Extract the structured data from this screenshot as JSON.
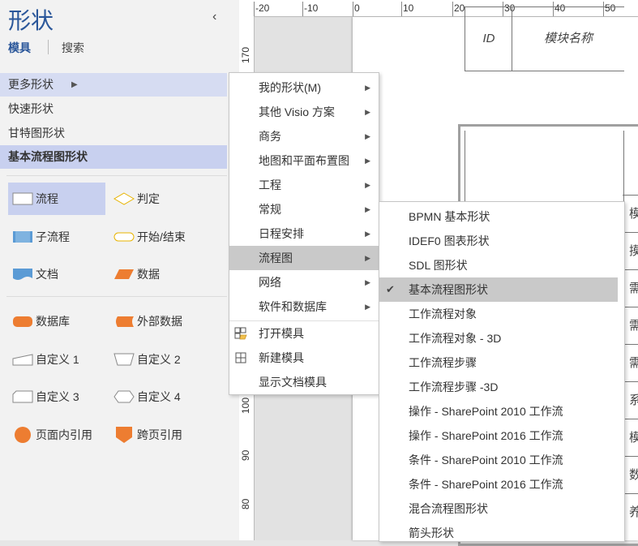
{
  "panel": {
    "title": "形状",
    "tabs": {
      "stencils": "模具",
      "search": "搜索"
    },
    "categories": [
      {
        "label": "更多形状"
      },
      {
        "label": "快速形状"
      },
      {
        "label": "甘特图形状"
      },
      {
        "label": "基本流程图形状"
      }
    ],
    "shapes": [
      {
        "label": "流程",
        "icon": "process-shape-icon"
      },
      {
        "label": "判定",
        "icon": "decision-shape-icon"
      },
      {
        "label": "子流程",
        "icon": "subprocess-shape-icon"
      },
      {
        "label": "开始/结束",
        "icon": "start-end-shape-icon"
      },
      {
        "label": "文档",
        "icon": "document-shape-icon"
      },
      {
        "label": "数据",
        "icon": "data-shape-icon"
      },
      {
        "label": "数据库",
        "icon": "database-shape-icon"
      },
      {
        "label": "外部数据",
        "icon": "external-data-shape-icon"
      },
      {
        "label": "自定义 1",
        "icon": "custom1-shape-icon"
      },
      {
        "label": "自定义 2",
        "icon": "custom2-shape-icon"
      },
      {
        "label": "自定义 3",
        "icon": "custom3-shape-icon"
      },
      {
        "label": "自定义 4",
        "icon": "custom4-shape-icon"
      },
      {
        "label": "页面内引用",
        "icon": "on-page-reference-icon"
      },
      {
        "label": "跨页引用",
        "icon": "off-page-reference-icon"
      }
    ]
  },
  "ruler": {
    "top_labels": [
      "-20",
      "-10",
      "0",
      "10",
      "20",
      "30",
      "40",
      "50"
    ],
    "left_labels": [
      "170",
      "100",
      "90",
      "80"
    ]
  },
  "canvas": {
    "table_headers": [
      "ID",
      "模块名称"
    ],
    "right_cells": [
      "模",
      "摸",
      "需",
      "需",
      "需",
      "系",
      "模",
      "数",
      "养"
    ]
  },
  "menu": {
    "items": [
      {
        "label": "我的形状(M)",
        "has_sub": true
      },
      {
        "label": "其他 Visio 方案",
        "has_sub": true
      },
      {
        "label": "商务",
        "has_sub": true
      },
      {
        "label": "地图和平面布置图",
        "has_sub": true
      },
      {
        "label": "工程",
        "has_sub": true
      },
      {
        "label": "常规",
        "has_sub": true
      },
      {
        "label": "日程安排",
        "has_sub": true
      },
      {
        "label": "流程图",
        "has_sub": true
      },
      {
        "label": "网络",
        "has_sub": true
      },
      {
        "label": "软件和数据库",
        "has_sub": true
      }
    ],
    "actions": [
      {
        "label": "打开模具",
        "icon": "open-stencil-icon"
      },
      {
        "label": "新建模具",
        "icon": "new-stencil-icon"
      },
      {
        "label": "显示文档模具",
        "icon": ""
      }
    ]
  },
  "submenu": {
    "items": [
      "BPMN 基本形状",
      "IDEF0 图表形状",
      "SDL 图形状",
      "基本流程图形状",
      "工作流程对象",
      "工作流程对象 - 3D",
      "工作流程步骤",
      "工作流程步骤 -3D",
      "操作 - SharePoint 2010 工作流",
      "操作 - SharePoint 2016 工作流",
      "条件 - SharePoint 2010 工作流",
      "条件 - SharePoint 2016 工作流",
      "混合流程图形状",
      "箭头形状"
    ],
    "checked_index": 3
  },
  "colors": {
    "accent": "#2b579a",
    "orange": "#ed7d31",
    "blue": "#5b9bd5"
  }
}
